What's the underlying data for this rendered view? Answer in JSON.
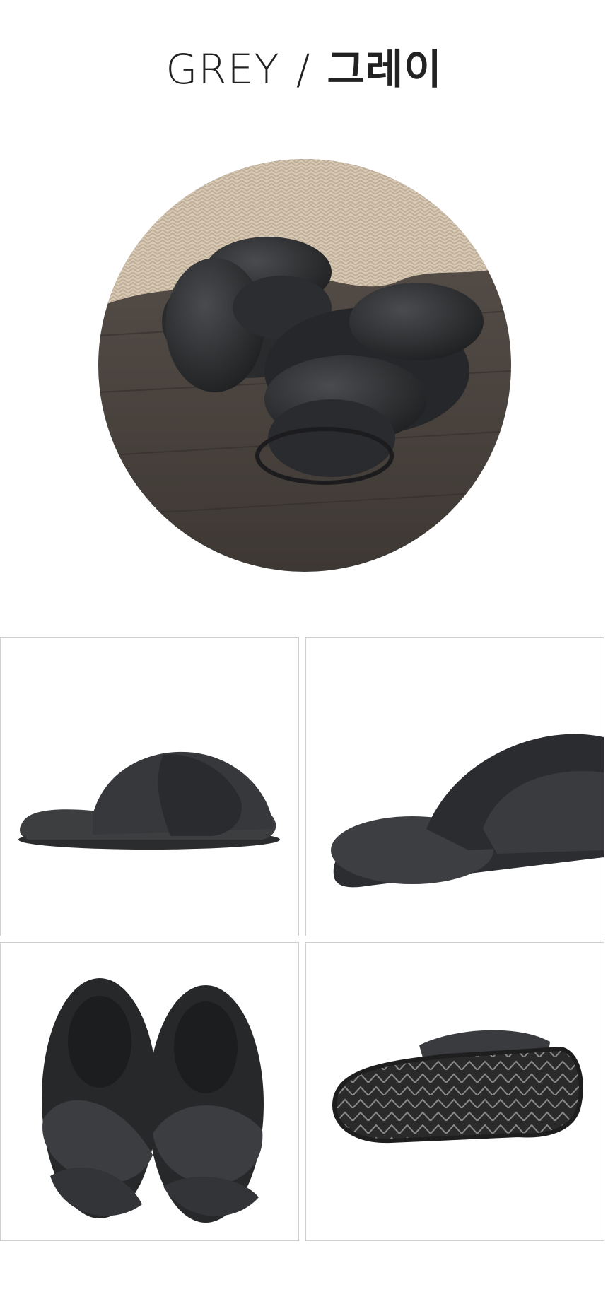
{
  "color_option": {
    "name_en": "GREY",
    "separator": "/",
    "name_ko": "그레이"
  },
  "images": {
    "hero": "grey-fur-slippers-on-wood-floor",
    "side": "grey-fur-slipper-side-view",
    "angle": "grey-fur-slipper-angle-view",
    "top": "grey-fur-slippers-top-view",
    "sole": "grey-fur-slipper-sole-view"
  },
  "colors": {
    "fur": "#3a3b3d",
    "fur_dark": "#232426",
    "floor": "#4a4440",
    "knit": "#d9ccba",
    "border": "#cfcfcf"
  }
}
